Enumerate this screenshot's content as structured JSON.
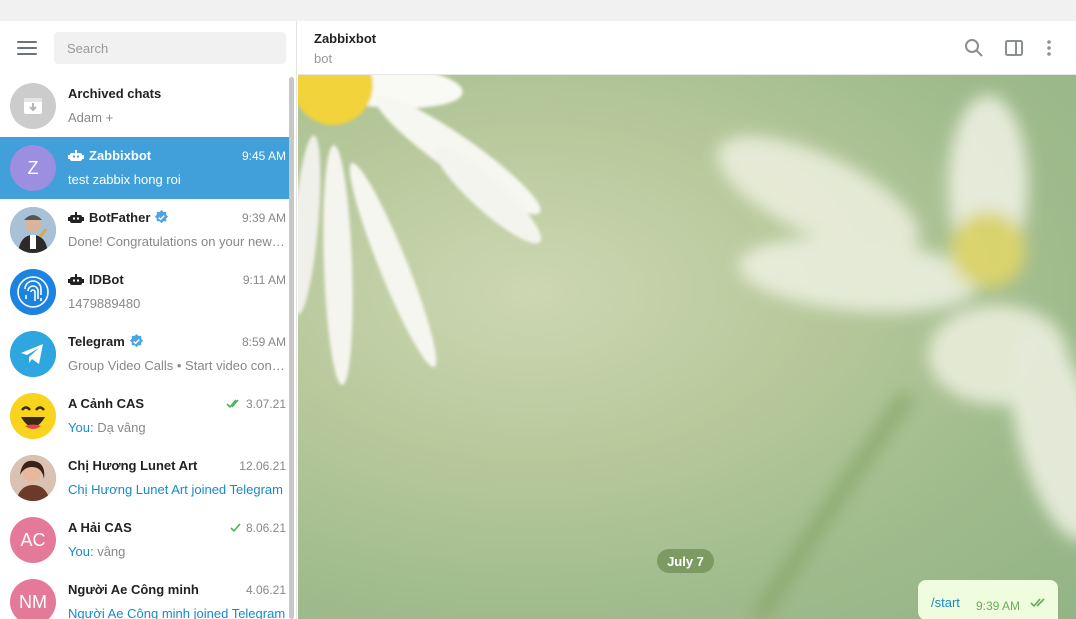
{
  "sidebar": {
    "search_placeholder": "Search",
    "chats": [
      {
        "name": "Archived chats",
        "message": "Adam +",
        "time": "",
        "avatar": "archive-icon",
        "active": false
      },
      {
        "name": "Zabbixbot",
        "message": "test zabbix hong roi",
        "time": "9:45 AM",
        "avatar_text": "Z",
        "avatar_color": "#9c8ee0",
        "bot": true,
        "active": true
      },
      {
        "name": "BotFather",
        "message": "Done! Congratulations on your new bot. You will find it at",
        "time": "9:39 AM",
        "bot": true,
        "verified": true
      },
      {
        "name": "IDBot",
        "message": "1479889480",
        "time": "9:11 AM",
        "bot": true
      },
      {
        "name": "Telegram",
        "message": "Group Video Calls • Start video conference",
        "time": "8:59 AM",
        "verified": true
      },
      {
        "name": "A Cảnh CAS",
        "you": "You:",
        "message": "Dạ vâng",
        "time": "3.07.21",
        "ticks": "double"
      },
      {
        "name": "Chị Hương Lunet Art",
        "message": "Chị Hương Lunet Art joined Telegram",
        "time": "12.06.21"
      },
      {
        "name": "A Hải CAS",
        "you": "You:",
        "message": "vâng",
        "time": "8.06.21",
        "ticks": "single",
        "avatar_text": "AC",
        "avatar_color": "#e4799a"
      },
      {
        "name": "Người Ae Công minh",
        "message": "Người Ae Công minh joined Telegram",
        "time": "4.06.21",
        "avatar_text": "NM",
        "avatar_color": "#e4799a"
      }
    ]
  },
  "header": {
    "title": "Zabbixbot",
    "subtitle": "bot"
  },
  "conversation": {
    "date": "July 7",
    "messages": [
      {
        "text": "/start",
        "time": "9:39 AM",
        "status": "read"
      }
    ]
  },
  "colors": {
    "accent": "#419fd9",
    "link": "#168acd",
    "bubble": "#effdde"
  }
}
